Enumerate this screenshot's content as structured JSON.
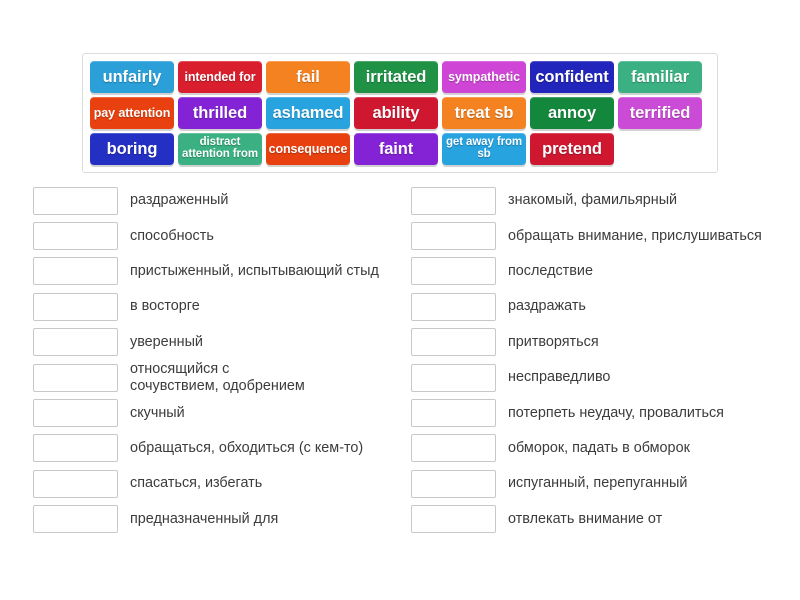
{
  "tile_bank": {
    "name": "word-tile-bank",
    "tiles": [
      {
        "label": "unfairly",
        "color": "#2a9fd8",
        "size": "s-lg"
      },
      {
        "label": "intended for",
        "color": "#d91f2d",
        "size": "s-sm"
      },
      {
        "label": "fail",
        "color": "#f58220",
        "size": "s-lg"
      },
      {
        "label": "irritated",
        "color": "#1f9246",
        "size": "s-lg"
      },
      {
        "label": "sympathetic",
        "color": "#cf45d6",
        "size": "s-sm"
      },
      {
        "label": "confident",
        "color": "#2225bb",
        "size": "s-lg"
      },
      {
        "label": "familiar",
        "color": "#3bb183",
        "size": "s-lg"
      },
      {
        "label": "pay attention",
        "color": "#e8400f",
        "size": "s-sm"
      },
      {
        "label": "thrilled",
        "color": "#8423d6",
        "size": "s-lg"
      },
      {
        "label": "ashamed",
        "color": "#27a3e0",
        "size": "s-lg"
      },
      {
        "label": "ability",
        "color": "#cf1730",
        "size": "s-lg"
      },
      {
        "label": "treat sb",
        "color": "#f58220",
        "size": "s-lg"
      },
      {
        "label": "annoy",
        "color": "#13883c",
        "size": "s-lg"
      },
      {
        "label": "terrified",
        "color": "#cb4ad6",
        "size": "s-lg"
      },
      {
        "label": "boring",
        "color": "#2430c4",
        "size": "s-lg"
      },
      {
        "label": "distract\nattention from",
        "color": "#3bb183",
        "size": "s-xs"
      },
      {
        "label": "consequence",
        "color": "#e8400f",
        "size": "s-sm"
      },
      {
        "label": "faint",
        "color": "#8423d6",
        "size": "s-lg"
      },
      {
        "label": "get away\nfrom sb",
        "color": "#27a3e0",
        "size": "s-xs"
      },
      {
        "label": "pretend",
        "color": "#cf1730",
        "size": "s-lg"
      },
      {
        "label": "",
        "color": "transparent",
        "size": "s-lg",
        "empty": true
      }
    ]
  },
  "left_column": {
    "name": "answer-column-left",
    "rows": [
      {
        "slot_value": "",
        "term": "раздраженный"
      },
      {
        "slot_value": "",
        "term": "способность"
      },
      {
        "slot_value": "",
        "term": "пристыженный, испытывающий стыд"
      },
      {
        "slot_value": "",
        "term": "в восторге"
      },
      {
        "slot_value": "",
        "term": "уверенный"
      },
      {
        "slot_value": "",
        "term": "относящийся с\nсочувствием, одобрением"
      },
      {
        "slot_value": "",
        "term": "скучный"
      },
      {
        "slot_value": "",
        "term": "обращаться, обходиться (с кем-то)"
      },
      {
        "slot_value": "",
        "term": "спасаться, избегать"
      },
      {
        "slot_value": "",
        "term": "предназначенный для"
      }
    ]
  },
  "right_column": {
    "name": "answer-column-right",
    "rows": [
      {
        "slot_value": "",
        "term": "знакомый, фамильярный"
      },
      {
        "slot_value": "",
        "term": "обращать внимание, прислушиваться"
      },
      {
        "slot_value": "",
        "term": "последствие"
      },
      {
        "slot_value": "",
        "term": "раздражать"
      },
      {
        "slot_value": "",
        "term": "притворяться"
      },
      {
        "slot_value": "",
        "term": "несправедливо"
      },
      {
        "slot_value": "",
        "term": "потерпеть неудачу, провалиться"
      },
      {
        "slot_value": "",
        "term": "обморок, падать в обморок"
      },
      {
        "slot_value": "",
        "term": "испуганный, перепуганный"
      },
      {
        "slot_value": "",
        "term": "отвлекать внимание от"
      }
    ]
  },
  "colors": {
    "page_background": "#ffffff",
    "panel_border": "#dcdcdc",
    "slot_border": "#c8c8c8",
    "term_text": "#3c3c3c"
  }
}
